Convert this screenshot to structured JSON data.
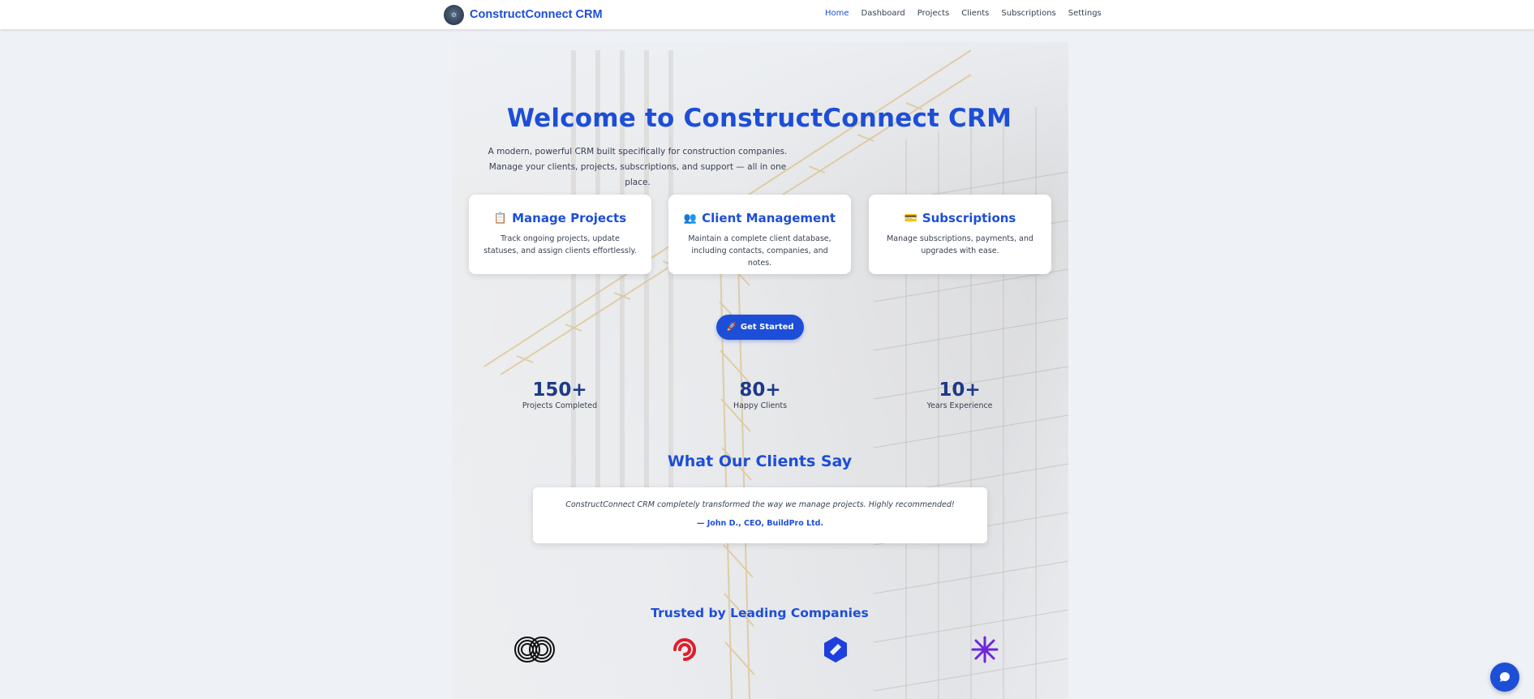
{
  "nav": {
    "brand": "ConstructConnect CRM",
    "links": [
      "Home",
      "Dashboard",
      "Projects",
      "Clients",
      "Subscriptions",
      "Settings"
    ],
    "active": "Home"
  },
  "hero": {
    "title": "Welcome to ConstructConnect CRM",
    "description": "A modern, powerful CRM built specifically for construction companies. Manage your clients, projects, subscriptions, and support — all in one place."
  },
  "features": [
    {
      "icon": "📋",
      "title": "Manage Projects",
      "desc": "Track ongoing projects, update statuses, and assign clients effortlessly."
    },
    {
      "icon": "👥",
      "title": "Client Management",
      "desc": "Maintain a complete client database, including contacts, companies, and notes."
    },
    {
      "icon": "💳",
      "title": "Subscriptions",
      "desc": "Manage subscriptions, payments, and upgrades with ease."
    }
  ],
  "cta": {
    "icon": "🚀",
    "label": "Get Started"
  },
  "stats": [
    {
      "value": "150+",
      "label": "Projects Completed"
    },
    {
      "value": "80+",
      "label": "Happy Clients"
    },
    {
      "value": "10+",
      "label": "Years Experience"
    }
  ],
  "testimonials": {
    "title": "What Our Clients Say",
    "quote": "ConstructConnect CRM completely transformed the way we manage projects. Highly recommended!",
    "author": "— John D., CEO, BuildPro Ltd."
  },
  "trusted": {
    "title": "Trusted by Leading Companies",
    "logos": [
      "infinity-rings-logo",
      "red-swirl-logo",
      "blue-hexagon-logo",
      "purple-star-logo"
    ]
  },
  "colors": {
    "accent": "#1d4ed8",
    "stat": "#1e3a8a",
    "background": "#eef1f6",
    "logo_red": "#e11d2a",
    "logo_blue": "#1d3fe0",
    "logo_purple": "#6d28d9"
  },
  "chat": {
    "icon": "chat-bubble-icon"
  }
}
